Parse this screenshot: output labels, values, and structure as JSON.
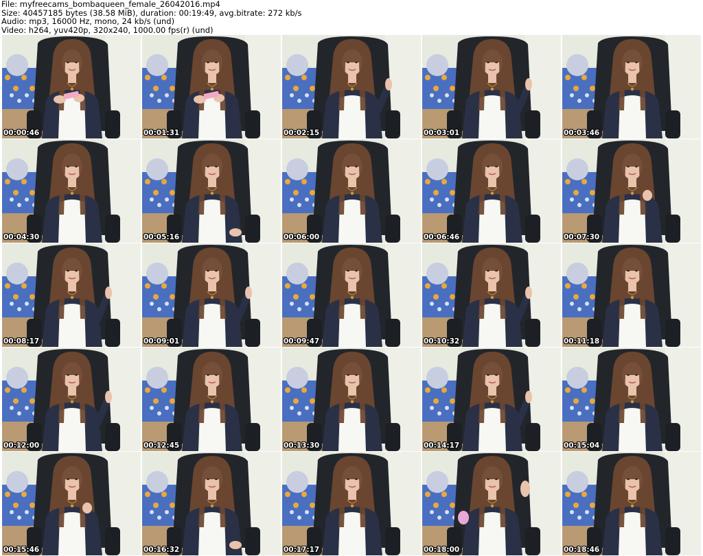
{
  "header": {
    "file_line": "File: myfreecams_bombaqueen_female_26042016.mp4",
    "size_line": "Size: 40457185 bytes (38.58 MiB), duration: 00:19:49, avg.bitrate: 272 kb/s",
    "audio_line": "Audio: mp3, 16000 Hz, mono, 24 kb/s (und)",
    "video_line": "Video: h264, yuv420p, 320x240, 1000.00 fps(r) (und)"
  },
  "colors": {
    "wall": "#e7eadf",
    "chair": "#22262b",
    "hair": "#6a4530",
    "skin": "#e9c3ac",
    "top": "#f7f7f3",
    "cardigan": "#2a3146",
    "pillow_blue": "#4a6fc0",
    "pillow_accent": "#e9a93a",
    "floor": "#b99a72"
  },
  "thumbnails": [
    {
      "time": "00:00:46",
      "pose": "phone"
    },
    {
      "time": "00:01:31",
      "pose": "phone"
    },
    {
      "time": "00:02:15",
      "pose": "hand-right"
    },
    {
      "time": "00:03:01",
      "pose": "hand-right"
    },
    {
      "time": "00:03:46",
      "pose": "neutral"
    },
    {
      "time": "00:04:30",
      "pose": "neutral"
    },
    {
      "time": "00:05:16",
      "pose": "hand-low"
    },
    {
      "time": "00:06:00",
      "pose": "neutral"
    },
    {
      "time": "00:06:46",
      "pose": "neutral"
    },
    {
      "time": "00:07:30",
      "pose": "hand-chest"
    },
    {
      "time": "00:08:17",
      "pose": "hand-right"
    },
    {
      "time": "00:09:01",
      "pose": "hand-right"
    },
    {
      "time": "00:09:47",
      "pose": "neutral"
    },
    {
      "time": "00:10:32",
      "pose": "hand-right"
    },
    {
      "time": "00:11:18",
      "pose": "neutral"
    },
    {
      "time": "00:12:00",
      "pose": "hand-right"
    },
    {
      "time": "00:12:45",
      "pose": "neutral"
    },
    {
      "time": "00:13:30",
      "pose": "neutral"
    },
    {
      "time": "00:14:17",
      "pose": "hand-right"
    },
    {
      "time": "00:15:04",
      "pose": "neutral"
    },
    {
      "time": "00:15:46",
      "pose": "hand-chest"
    },
    {
      "time": "00:16:32",
      "pose": "hand-low"
    },
    {
      "time": "00:17:17",
      "pose": "neutral"
    },
    {
      "time": "00:18:00",
      "pose": "wave"
    },
    {
      "time": "00:18:46",
      "pose": "neutral"
    }
  ]
}
